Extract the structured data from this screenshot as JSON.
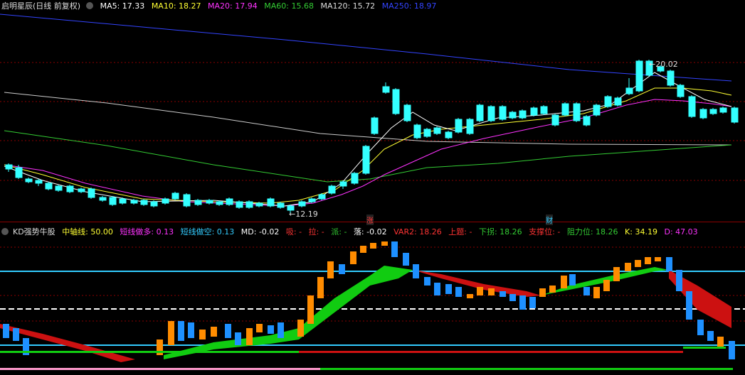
{
  "main": {
    "title": "启明星辰(日线 前复权)",
    "indicators": [
      {
        "label": "MA5: 17.33",
        "color": "#ffffff"
      },
      {
        "label": "MA10: 18.27",
        "color": "#ffff33"
      },
      {
        "label": "MA20: 17.94",
        "color": "#ff33ff"
      },
      {
        "label": "MA60: 15.68",
        "color": "#33cc33"
      },
      {
        "label": "MA120: 15.72",
        "color": "#dddddd"
      },
      {
        "label": "MA250: 18.97",
        "color": "#3344ff"
      }
    ],
    "high_label": "20.02",
    "low_label": "12.19",
    "markers": [
      {
        "text": "涨",
        "color": "#ff3333"
      },
      {
        "text": "财",
        "color": "#33ccff"
      }
    ]
  },
  "sub": {
    "title": "KD强势牛股",
    "indicators": [
      {
        "label": "中轴线: 50.00",
        "color": "#ffff33"
      },
      {
        "label": "短线做多: 0.13",
        "color": "#ff33ff"
      },
      {
        "label": "短线做空: 0.13",
        "color": "#33ccff"
      },
      {
        "label": "MD: -0.02",
        "color": "#ffffff"
      },
      {
        "label": "吸: -",
        "color": "#ff3333"
      },
      {
        "label": "拉: -",
        "color": "#ff3333"
      },
      {
        "label": "派: -",
        "color": "#33cc33"
      },
      {
        "label": "落: -0.02",
        "color": "#ffffff"
      },
      {
        "label": "VAR2: 18.26",
        "color": "#ff3333"
      },
      {
        "label": "上题: -",
        "color": "#ff3333"
      },
      {
        "label": "下拐: 18.26",
        "color": "#33cc33"
      },
      {
        "label": "支撑位: -",
        "color": "#ff3333"
      },
      {
        "label": "阻力位: 18.26",
        "color": "#33cc33"
      },
      {
        "label": "K: 34.19",
        "color": "#ffff33"
      },
      {
        "label": "D: 47.03",
        "color": "#ff33ff"
      }
    ]
  },
  "colors": {
    "up": "#ff3333",
    "down": "#33ffff",
    "grid": "#8b0000"
  }
}
